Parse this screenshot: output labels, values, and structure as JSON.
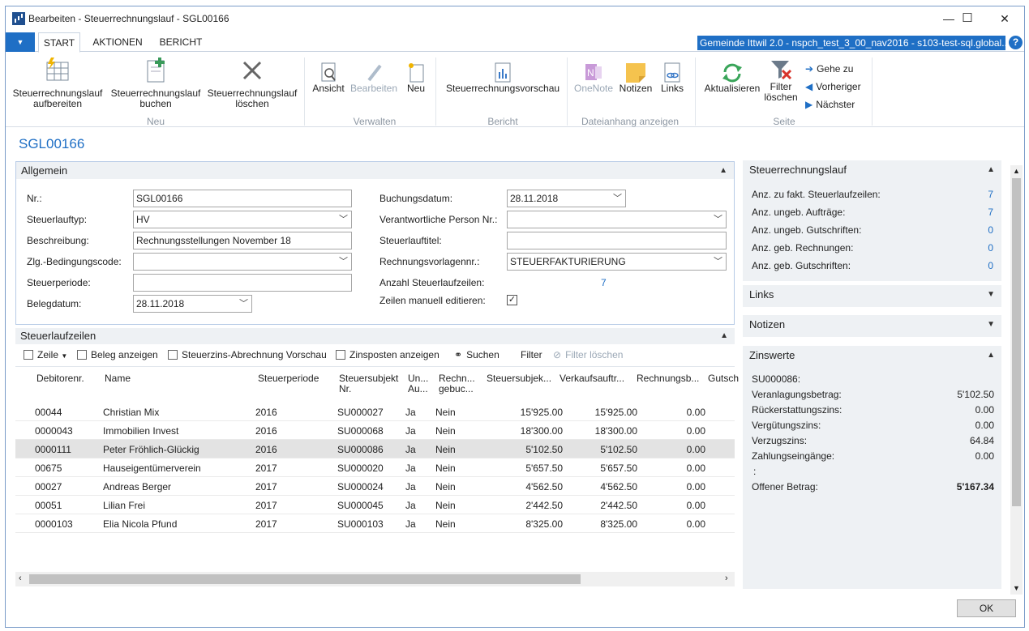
{
  "window": {
    "title": "Bearbeiten - Steuerrechnungslauf - SGL00166",
    "minimize": "—",
    "maximize": "☐",
    "close": "✕"
  },
  "tabs": {
    "file": "▼",
    "start": "START",
    "aktionen": "AKTIONEN",
    "bericht": "BERICHT"
  },
  "server": "Gemeinde Ittwil 2.0 - nspch_test_3_00_nav2016 - s103-test-sql.global....",
  "help": "?",
  "ribbon": {
    "aufbereiten": "Steuerrechnungslauf aufbereiten",
    "buchen": "Steuerrechnungslauf buchen",
    "loeschen": "Steuerrechnungslauf löschen",
    "group_neu": "Neu",
    "ansicht": "Ansicht",
    "bearbeiten": "Bearbeiten",
    "neu": "Neu",
    "group_verwalten": "Verwalten",
    "vorschau": "Steuerrechnungsvorschau",
    "group_bericht": "Bericht",
    "onenote": "OneNote",
    "notizen": "Notizen",
    "links": "Links",
    "group_dateianhang": "Dateianhang anzeigen",
    "aktualisieren": "Aktualisieren",
    "filter_loeschen": "Filter löschen",
    "group_seite": "Seite",
    "gehe_zu": "Gehe zu",
    "vorheriger": "Vorheriger",
    "naechster": "Nächster"
  },
  "page_title": "SGL00166",
  "allgemein": {
    "header": "Allgemein",
    "nr_label": "Nr.:",
    "nr": "SGL00166",
    "typ_label": "Steuerlauftyp:",
    "typ": "HV",
    "beschr_label": "Beschreibung:",
    "beschr": "Rechnungsstellungen November 18",
    "zlg_label": "Zlg.-Bedingungscode:",
    "zlg": "",
    "periode_label": "Steuerperiode:",
    "periode": "",
    "belegdatum_label": "Belegdatum:",
    "belegdatum": "28.11.2018",
    "buchungsdatum_label": "Buchungsdatum:",
    "buchungsdatum": "28.11.2018",
    "verantw_label": "Verantwortliche Person Nr.:",
    "verantw": "",
    "titel_label": "Steuerlauftitel:",
    "titel": "",
    "vorlage_label": "Rechnungsvorlagennr.:",
    "vorlage": "STEUERFAKTURIERUNG",
    "anzahl_label": "Anzahl Steuerlaufzeilen:",
    "anzahl": "7",
    "manuell_label": "Zeilen manuell editieren:",
    "manuell_check": "✓"
  },
  "lines": {
    "header": "Steuerlaufzeilen",
    "tb_zeile": "Zeile",
    "tb_beleg": "Beleg anzeigen",
    "tb_vorschau": "Steuerzins-Abrechnung Vorschau",
    "tb_zinsposten": "Zinsposten anzeigen",
    "tb_suchen": "Suchen",
    "tb_filter": "Filter",
    "tb_filter_loeschen": "Filter löschen",
    "columns": [
      "Debitorenr.",
      "Name",
      "Steuerperiode",
      "Steuersubjekt Nr.",
      "Un... Au...",
      "Rechn... gebuc...",
      "Steuersubjek...",
      "Verkaufsauftr...",
      "Rechnungsb...",
      "Gutsch"
    ],
    "rows": [
      [
        "00044",
        "Christian Mix",
        "2016",
        "SU000027",
        "Ja",
        "Nein",
        "15'925.00",
        "15'925.00",
        "0.00"
      ],
      [
        "0000043",
        "Immobilien Invest",
        "2016",
        "SU000068",
        "Ja",
        "Nein",
        "18'300.00",
        "18'300.00",
        "0.00"
      ],
      [
        "0000111",
        "Peter Fröhlich-Glückig",
        "2016",
        "SU000086",
        "Ja",
        "Nein",
        "5'102.50",
        "5'102.50",
        "0.00"
      ],
      [
        "00675",
        "Hauseigentümerverein",
        "2017",
        "SU000020",
        "Ja",
        "Nein",
        "5'657.50",
        "5'657.50",
        "0.00"
      ],
      [
        "00027",
        "Andreas Berger",
        "2017",
        "SU000024",
        "Ja",
        "Nein",
        "4'562.50",
        "4'562.50",
        "0.00"
      ],
      [
        "00051",
        "Lilian Frei",
        "2017",
        "SU000045",
        "Ja",
        "Nein",
        "2'442.50",
        "2'442.50",
        "0.00"
      ],
      [
        "0000103",
        "Elia Nicola Pfund",
        "2017",
        "SU000103",
        "Ja",
        "Nein",
        "8'325.00",
        "8'325.00",
        "0.00"
      ]
    ]
  },
  "factbox": {
    "lauf_header": "Steuerrechnungslauf",
    "lauf_items": [
      {
        "label": "Anz. zu fakt. Steuerlaufzeilen:",
        "value": "7"
      },
      {
        "label": "Anz. ungeb. Aufträge:",
        "value": "7"
      },
      {
        "label": "Anz. ungeb. Gutschriften:",
        "value": "0"
      },
      {
        "label": "Anz. geb. Rechnungen:",
        "value": "0"
      },
      {
        "label": "Anz. geb. Gutschriften:",
        "value": "0"
      }
    ],
    "links_header": "Links",
    "notizen_header": "Notizen",
    "zins_header": "Zinswerte",
    "zins_id": "SU000086:",
    "zins_items": [
      {
        "label": "Veranlagungsbetrag:",
        "value": "5'102.50"
      },
      {
        "label": "Rückerstattungszins:",
        "value": "0.00"
      },
      {
        "label": "Vergütungszins:",
        "value": "0.00"
      },
      {
        "label": "Verzugszins:",
        "value": "64.84"
      },
      {
        "label": "Zahlungseingänge:",
        "value": "0.00"
      }
    ],
    "zins_colon": ":",
    "offen_label": "Offener Betrag:",
    "offen": "5'167.34"
  },
  "ok": "OK"
}
